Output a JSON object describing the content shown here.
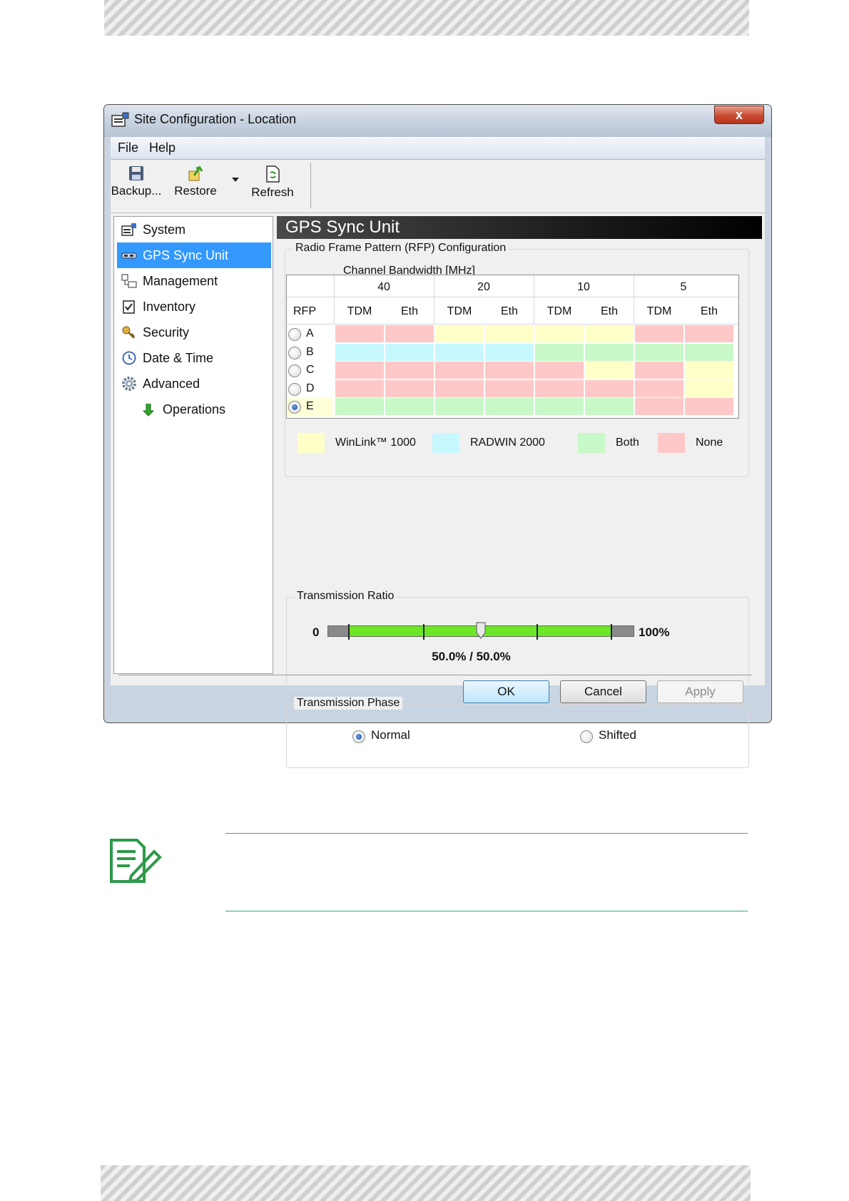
{
  "window": {
    "title": "Site Configuration - Location",
    "close_label": "x"
  },
  "menu": {
    "file": "File",
    "help": "Help"
  },
  "toolbar": {
    "backup": "Backup...",
    "restore": "Restore",
    "refresh": "Refresh"
  },
  "nav": {
    "items": [
      {
        "label": "System",
        "icon": "system-icon"
      },
      {
        "label": "GPS Sync Unit",
        "icon": "gps-sync-icon",
        "selected": true
      },
      {
        "label": "Management",
        "icon": "management-icon"
      },
      {
        "label": "Inventory",
        "icon": "inventory-icon"
      },
      {
        "label": "Security",
        "icon": "security-icon"
      },
      {
        "label": "Date & Time",
        "icon": "clock-icon"
      },
      {
        "label": "Advanced",
        "icon": "gear-icon"
      },
      {
        "label": "Operations",
        "icon": "arrow-down-icon"
      }
    ]
  },
  "panel": {
    "title": "GPS Sync Unit",
    "rfp": {
      "group_title": "Radio Frame Pattern (RFP) Configuration",
      "channel_bandwidth_label": "Channel Bandwidth [MHz]",
      "rfp_column_label": "RFP",
      "bandwidths": [
        "40",
        "20",
        "10",
        "5"
      ],
      "columns": [
        "TDM",
        "Eth",
        "TDM",
        "Eth",
        "TDM",
        "Eth",
        "TDM",
        "Eth"
      ],
      "rows": [
        {
          "label": "A",
          "selected": false,
          "cells": [
            "none",
            "none",
            "winlink",
            "winlink",
            "winlink",
            "winlink",
            "none",
            "none"
          ]
        },
        {
          "label": "B",
          "selected": false,
          "cells": [
            "radwin",
            "radwin",
            "radwin",
            "radwin",
            "both",
            "both",
            "both",
            "both"
          ]
        },
        {
          "label": "C",
          "selected": false,
          "cells": [
            "none",
            "none",
            "none",
            "none",
            "none",
            "winlink",
            "none",
            "winlink"
          ]
        },
        {
          "label": "D",
          "selected": false,
          "cells": [
            "none",
            "none",
            "none",
            "none",
            "none",
            "none",
            "none",
            "winlink"
          ]
        },
        {
          "label": "E",
          "selected": true,
          "cells": [
            "both",
            "both",
            "both",
            "both",
            "both",
            "both",
            "none",
            "none"
          ]
        }
      ],
      "legend": [
        {
          "key": "winlink",
          "label": "WinLink™ 1000",
          "color": "#ffffc8"
        },
        {
          "key": "radwin",
          "label": "RADWIN 2000",
          "color": "#c8f8ff"
        },
        {
          "key": "both",
          "label": "Both",
          "color": "#c8f8c8"
        },
        {
          "key": "none",
          "label": "None",
          "color": "#ffc8c8"
        }
      ]
    },
    "transmission_ratio": {
      "group_title": "Transmission Ratio",
      "min_label": "0",
      "max_label": "100%",
      "value_label": "50.0% / 50.0%",
      "value_fraction": 0.5
    },
    "transmission_phase": {
      "group_title": "Transmission Phase",
      "options": [
        {
          "label": "Normal",
          "selected": true
        },
        {
          "label": "Shifted",
          "selected": false
        }
      ]
    }
  },
  "buttons": {
    "ok": "OK",
    "cancel": "Cancel",
    "apply": "Apply"
  }
}
